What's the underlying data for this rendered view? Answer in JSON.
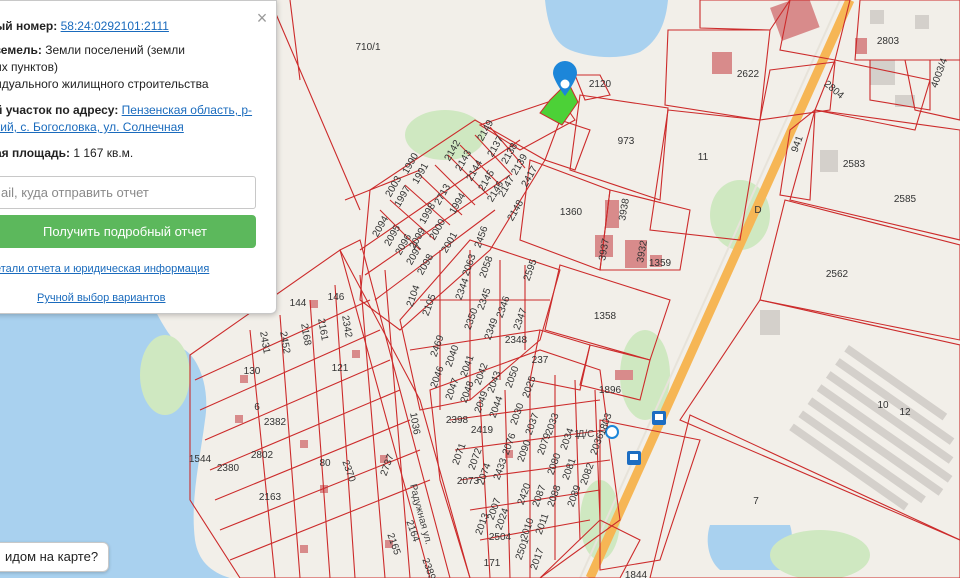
{
  "panel": {
    "cadastral_label": "ый номер:",
    "cadastral_number": "58:24:0292101:2111",
    "category_label": "земель:",
    "category_value_line1": "Земли поселений (земли",
    "category_value_line2": "их пунктов)",
    "category_value_line3": "идуального жилищного строительства",
    "address_label": "й участок по адресу:",
    "address_line1": "Пензенская область, р-",
    "address_line2": "кий, с. Богословка, ул. Солнечная",
    "area_label": "ая площадь:",
    "area_value": "1 167 кв.м.",
    "email_placeholder": "ail, куда отправить отчет",
    "report_button": "Получить подробный отчет",
    "details_link": "етали отчета и юридическая информация",
    "manual_link": "Ручной выбор вариантов",
    "close_symbol": "×"
  },
  "help_bubble": "идом на карте?",
  "colors": {
    "parcel_border": "#cc2b2b",
    "water": "#a9d1ef",
    "selected_parcel": "#4cd137",
    "marker": "#1c86d9",
    "road": "#f6b655",
    "button": "#5cb85c",
    "link": "#1a6bbd"
  },
  "map": {
    "labels": [
      {
        "id": "p710",
        "text": "710/1"
      },
      {
        "id": "p2120",
        "text": "2120"
      },
      {
        "id": "p2622",
        "text": "2622"
      },
      {
        "id": "p2803",
        "text": "2803"
      },
      {
        "id": "p2804",
        "text": "2804"
      },
      {
        "id": "p4003",
        "text": "4003/4"
      },
      {
        "id": "p973",
        "text": "973"
      },
      {
        "id": "p11",
        "text": "11"
      },
      {
        "id": "p941",
        "text": "941"
      },
      {
        "id": "p2583",
        "text": "2583"
      },
      {
        "id": "p2585",
        "text": "2585"
      },
      {
        "id": "p1360",
        "text": "1360"
      },
      {
        "id": "p3938",
        "text": "3938"
      },
      {
        "id": "p3937",
        "text": "3937"
      },
      {
        "id": "p3932",
        "text": "3932"
      },
      {
        "id": "p1359",
        "text": "1359"
      },
      {
        "id": "p2562",
        "text": "2562"
      },
      {
        "id": "p1358",
        "text": "1358"
      },
      {
        "id": "p1896",
        "text": "1896"
      },
      {
        "id": "p10",
        "text": "10"
      },
      {
        "id": "p12",
        "text": "12"
      },
      {
        "id": "p7",
        "text": "7"
      },
      {
        "id": "p1036",
        "text": "1036"
      },
      {
        "id": "p2382",
        "text": "2382"
      },
      {
        "id": "p2802",
        "text": "2802"
      },
      {
        "id": "p1544",
        "text": "1544"
      },
      {
        "id": "p2380",
        "text": "2380"
      },
      {
        "id": "p2163",
        "text": "2163"
      },
      {
        "id": "p2370",
        "text": "2370"
      },
      {
        "id": "p2737",
        "text": "2737"
      },
      {
        "id": "p2165",
        "text": "2165"
      },
      {
        "id": "p2164",
        "text": "2164"
      },
      {
        "id": "p2389",
        "text": "2389"
      },
      {
        "id": "p2431",
        "text": "2431"
      },
      {
        "id": "p2452",
        "text": "2452"
      },
      {
        "id": "p2168",
        "text": "2168"
      },
      {
        "id": "p2161",
        "text": "2161"
      },
      {
        "id": "p2342",
        "text": "2342"
      },
      {
        "id": "p1990",
        "text": "1990"
      },
      {
        "id": "p2003",
        "text": "2003"
      },
      {
        "id": "p2094",
        "text": "2094"
      },
      {
        "id": "p2095",
        "text": "2095"
      },
      {
        "id": "p2096",
        "text": "2096"
      },
      {
        "id": "p2097",
        "text": "2097"
      },
      {
        "id": "p2098",
        "text": "2098"
      },
      {
        "id": "p2099",
        "text": "2099"
      },
      {
        "id": "p2104",
        "text": "2104"
      },
      {
        "id": "p2105",
        "text": "2105"
      },
      {
        "id": "p1997",
        "text": "1997"
      },
      {
        "id": "p1991",
        "text": "1991"
      },
      {
        "id": "p1998",
        "text": "1998"
      },
      {
        "id": "p2713",
        "text": "2713"
      },
      {
        "id": "p2000",
        "text": "2000"
      },
      {
        "id": "p1994",
        "text": "1994"
      },
      {
        "id": "p2001",
        "text": "2001"
      },
      {
        "id": "p2456",
        "text": "2456"
      },
      {
        "id": "p2063",
        "text": "2063"
      },
      {
        "id": "p2058",
        "text": "2058"
      },
      {
        "id": "p2344",
        "text": "2344"
      },
      {
        "id": "p2350",
        "text": "2350"
      },
      {
        "id": "p2345",
        "text": "2345"
      },
      {
        "id": "p2349",
        "text": "2349"
      },
      {
        "id": "p2346",
        "text": "2346"
      },
      {
        "id": "p2347",
        "text": "2347"
      },
      {
        "id": "p2348",
        "text": "2348"
      },
      {
        "id": "p2595",
        "text": "2595"
      },
      {
        "id": "p2142",
        "text": "2142"
      },
      {
        "id": "p2143",
        "text": "2143"
      },
      {
        "id": "p2144",
        "text": "2144"
      },
      {
        "id": "p2145",
        "text": "2145"
      },
      {
        "id": "p2146",
        "text": "2146"
      },
      {
        "id": "p2147",
        "text": "2147"
      },
      {
        "id": "p2148",
        "text": "2148"
      },
      {
        "id": "p2149",
        "text": "2149"
      },
      {
        "id": "p2137",
        "text": "2137"
      },
      {
        "id": "p2138",
        "text": "2138"
      },
      {
        "id": "p2139",
        "text": "2139"
      },
      {
        "id": "p2417",
        "text": "2417"
      },
      {
        "id": "p2469",
        "text": "2469"
      },
      {
        "id": "p2046",
        "text": "2046"
      },
      {
        "id": "p2040",
        "text": "2040"
      },
      {
        "id": "p2047",
        "text": "2047"
      },
      {
        "id": "p2041",
        "text": "2041"
      },
      {
        "id": "p2048",
        "text": "2048"
      },
      {
        "id": "p2042",
        "text": "2042"
      },
      {
        "id": "p2049",
        "text": "2049"
      },
      {
        "id": "p2043",
        "text": "2043"
      },
      {
        "id": "p2044",
        "text": "2044"
      },
      {
        "id": "p2050",
        "text": "2050"
      },
      {
        "id": "p2025",
        "text": "2025"
      },
      {
        "id": "p2030",
        "text": "2030"
      },
      {
        "id": "p2037",
        "text": "2037"
      },
      {
        "id": "p2398",
        "text": "2398"
      },
      {
        "id": "p2419",
        "text": "2419"
      },
      {
        "id": "p2071",
        "text": "2071"
      },
      {
        "id": "p2072",
        "text": "2072"
      },
      {
        "id": "p2073",
        "text": "2073"
      },
      {
        "id": "p2076",
        "text": "2076"
      },
      {
        "id": "p2090",
        "text": "2090"
      },
      {
        "id": "p2079",
        "text": "2079"
      },
      {
        "id": "p2433",
        "text": "2433"
      },
      {
        "id": "p2074",
        "text": "2074"
      },
      {
        "id": "p2087",
        "text": "2087"
      },
      {
        "id": "p2088",
        "text": "2088"
      },
      {
        "id": "p2089",
        "text": "2089"
      },
      {
        "id": "p2080",
        "text": "2080"
      },
      {
        "id": "p2081",
        "text": "2081"
      },
      {
        "id": "p2082",
        "text": "2082"
      },
      {
        "id": "p2034",
        "text": "2034"
      },
      {
        "id": "p2033",
        "text": "2033"
      },
      {
        "id": "p2036",
        "text": "2036"
      },
      {
        "id": "p1803",
        "text": "1803"
      },
      {
        "id": "p2013",
        "text": "2013"
      },
      {
        "id": "p2007",
        "text": "2007"
      },
      {
        "id": "p2024",
        "text": "2024"
      },
      {
        "id": "p2504",
        "text": "2504"
      },
      {
        "id": "p2501",
        "text": "2501"
      },
      {
        "id": "p2010",
        "text": "2010"
      },
      {
        "id": "p2011",
        "text": "2011"
      },
      {
        "id": "p2017",
        "text": "2017"
      },
      {
        "id": "p2420",
        "text": "2420"
      },
      {
        "id": "p1844",
        "text": "1844"
      },
      {
        "id": "p144",
        "text": "144"
      },
      {
        "id": "p146",
        "text": "146"
      },
      {
        "id": "p130",
        "text": "130"
      },
      {
        "id": "p121",
        "text": "121"
      },
      {
        "id": "p6",
        "text": "6"
      },
      {
        "id": "p80",
        "text": "80"
      },
      {
        "id": "p171",
        "text": "171"
      },
      {
        "id": "p237",
        "text": "237"
      },
      {
        "id": "p1",
        "text": "1"
      },
      {
        "id": "pD",
        "text": "D"
      }
    ],
    "streets": [
      {
        "id": "s1",
        "text": "Радужная ул."
      },
      {
        "id": "s2",
        "text": "Д/С"
      }
    ]
  }
}
